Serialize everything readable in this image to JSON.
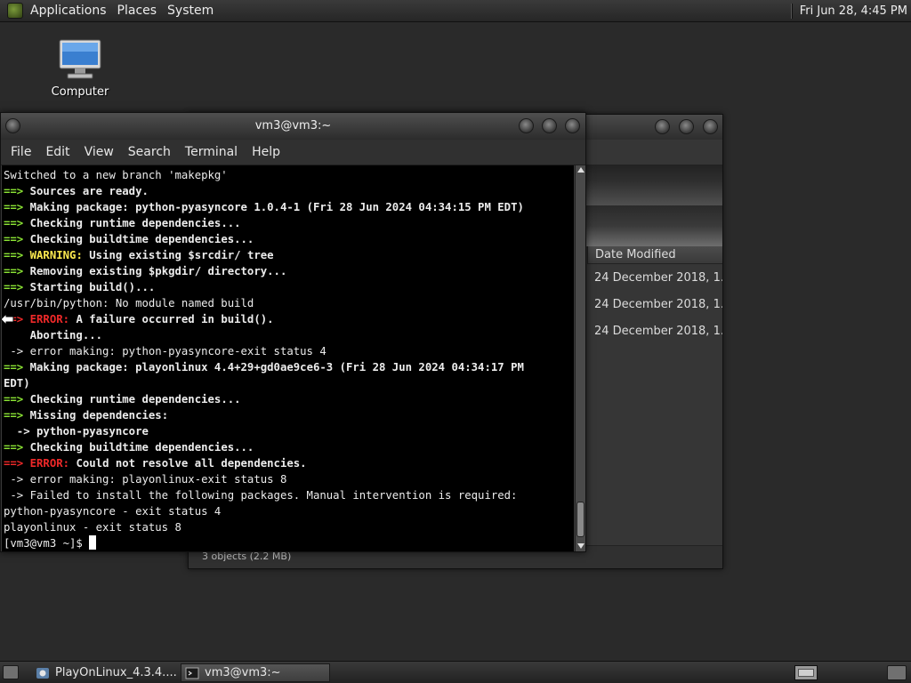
{
  "top_panel": {
    "menus": [
      "Applications",
      "Places",
      "System"
    ],
    "clock": "Fri Jun 28,  4:45 PM"
  },
  "desktop": {
    "icon_label": "Computer"
  },
  "file_window": {
    "column_header": "Date Modified",
    "rows": [
      "24 December 2018, 1...",
      "24 December 2018, 1...",
      "24 December 2018, 1..."
    ],
    "status": "3 objects (2.2 MB)"
  },
  "terminal": {
    "title": "vm3@vm3:~",
    "menu": [
      "File",
      "Edit",
      "View",
      "Search",
      "Terminal",
      "Help"
    ],
    "lines": [
      [
        {
          "t": "Switched to a new branch 'makepkg'",
          "s": ""
        }
      ],
      [
        {
          "t": "==> ",
          "s": "g"
        },
        {
          "t": "Sources are ready.",
          "s": "b"
        }
      ],
      [
        {
          "t": "==> ",
          "s": "g"
        },
        {
          "t": "Making package: python-pyasyncore 1.0.4-1 (Fri 28 Jun 2024 04:34:15 PM EDT)",
          "s": "b"
        }
      ],
      [
        {
          "t": "==> ",
          "s": "g"
        },
        {
          "t": "Checking runtime dependencies...",
          "s": "b"
        }
      ],
      [
        {
          "t": "==> ",
          "s": "g"
        },
        {
          "t": "Checking buildtime dependencies...",
          "s": "b"
        }
      ],
      [
        {
          "t": "==> ",
          "s": "g"
        },
        {
          "t": "WARNING:",
          "s": "y"
        },
        {
          "t": " Using existing $srcdir/ tree",
          "s": "b"
        }
      ],
      [
        {
          "t": "==> ",
          "s": "g"
        },
        {
          "t": "Removing existing $pkgdir/ directory...",
          "s": "b"
        }
      ],
      [
        {
          "t": "==> ",
          "s": "g"
        },
        {
          "t": "Starting build()...",
          "s": "b"
        }
      ],
      [
        {
          "t": "/usr/bin/python: No module named build",
          "s": ""
        }
      ],
      [
        {
          "t": "==> ",
          "s": "r"
        },
        {
          "t": "ERROR:",
          "s": "r"
        },
        {
          "t": " A failure occurred in build().",
          "s": "b"
        }
      ],
      [
        {
          "t": "    Aborting...",
          "s": "b"
        }
      ],
      [
        {
          "t": " -> error making: python-pyasyncore-exit status 4",
          "s": ""
        }
      ],
      [
        {
          "t": "==> ",
          "s": "g"
        },
        {
          "t": "Making package: playonlinux 4.4+29+gd0ae9ce6-3 (Fri 28 Jun 2024 04:34:17 PM",
          "s": "b"
        }
      ],
      [
        {
          "t": "EDT)",
          "s": "b"
        }
      ],
      [
        {
          "t": "==> ",
          "s": "g"
        },
        {
          "t": "Checking runtime dependencies...",
          "s": "b"
        }
      ],
      [
        {
          "t": "==> ",
          "s": "g"
        },
        {
          "t": "Missing dependencies:",
          "s": "b"
        }
      ],
      [
        {
          "t": "  -> ",
          "s": "b"
        },
        {
          "t": "python-pyasyncore",
          "s": "b"
        }
      ],
      [
        {
          "t": "==> ",
          "s": "g"
        },
        {
          "t": "Checking buildtime dependencies...",
          "s": "b"
        }
      ],
      [
        {
          "t": "==> ",
          "s": "r"
        },
        {
          "t": "ERROR:",
          "s": "r"
        },
        {
          "t": " Could not resolve all dependencies.",
          "s": "b"
        }
      ],
      [
        {
          "t": " -> error making: playonlinux-exit status 8",
          "s": ""
        }
      ],
      [
        {
          "t": " -> Failed to install the following packages. Manual intervention is required:",
          "s": ""
        }
      ],
      [
        {
          "t": "python-pyasyncore - exit status 4",
          "s": ""
        }
      ],
      [
        {
          "t": "playonlinux - exit status 8",
          "s": ""
        }
      ]
    ],
    "prompt": "[vm3@vm3 ~]$ "
  },
  "taskbar": {
    "tasks": [
      "PlayOnLinux_4.3.4....",
      "vm3@vm3:~"
    ]
  },
  "icons": {
    "logo": "gnome-foot-icon",
    "computer": "computer-monitor-icon",
    "pointer": "mouse-pointer-icon"
  }
}
